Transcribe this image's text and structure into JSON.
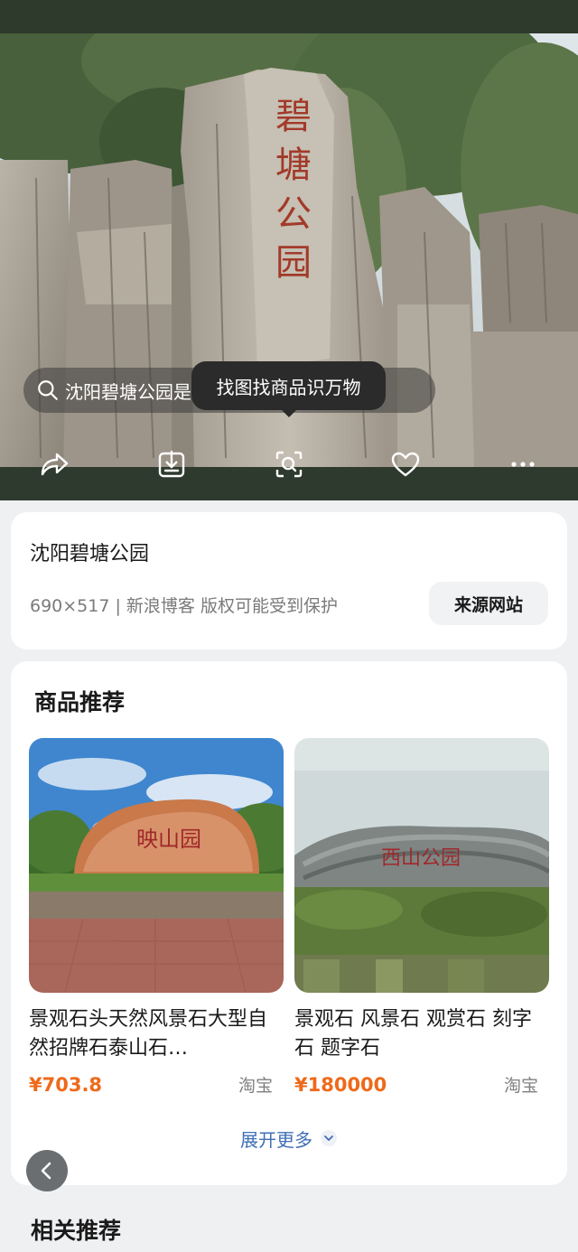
{
  "hero": {
    "query_text": "沈阳碧塘公园是公园",
    "tooltip": "找图找商品识万物",
    "stone_inscription": "碧塘公园"
  },
  "toolbar": {
    "share_icon": "share-icon",
    "download_icon": "download-icon",
    "scan_icon": "scan-icon",
    "favorite_icon": "heart-icon",
    "more_icon": "more-icon"
  },
  "info": {
    "title": "沈阳碧塘公园",
    "meta": "690×517 | 新浪博客 版权可能受到保护",
    "source_button": "来源网站"
  },
  "products": {
    "section_title": "商品推荐",
    "items": [
      {
        "name": "景观石头天然风景石大型自然招牌石泰山石…",
        "price": "¥703.8",
        "shop": "淘宝",
        "image_inscription": "映山园"
      },
      {
        "name": "景观石 风景石 观赏石 刻字石 题字石",
        "price": "¥180000",
        "shop": "淘宝",
        "image_inscription": "西山公园"
      }
    ],
    "expand_label": "展开更多"
  },
  "related": {
    "title": "相关推荐"
  },
  "colors": {
    "price": "#ee6a1a",
    "link": "#3f6fb5",
    "card_bg": "#ffffff",
    "page_bg": "#eef0f2"
  }
}
